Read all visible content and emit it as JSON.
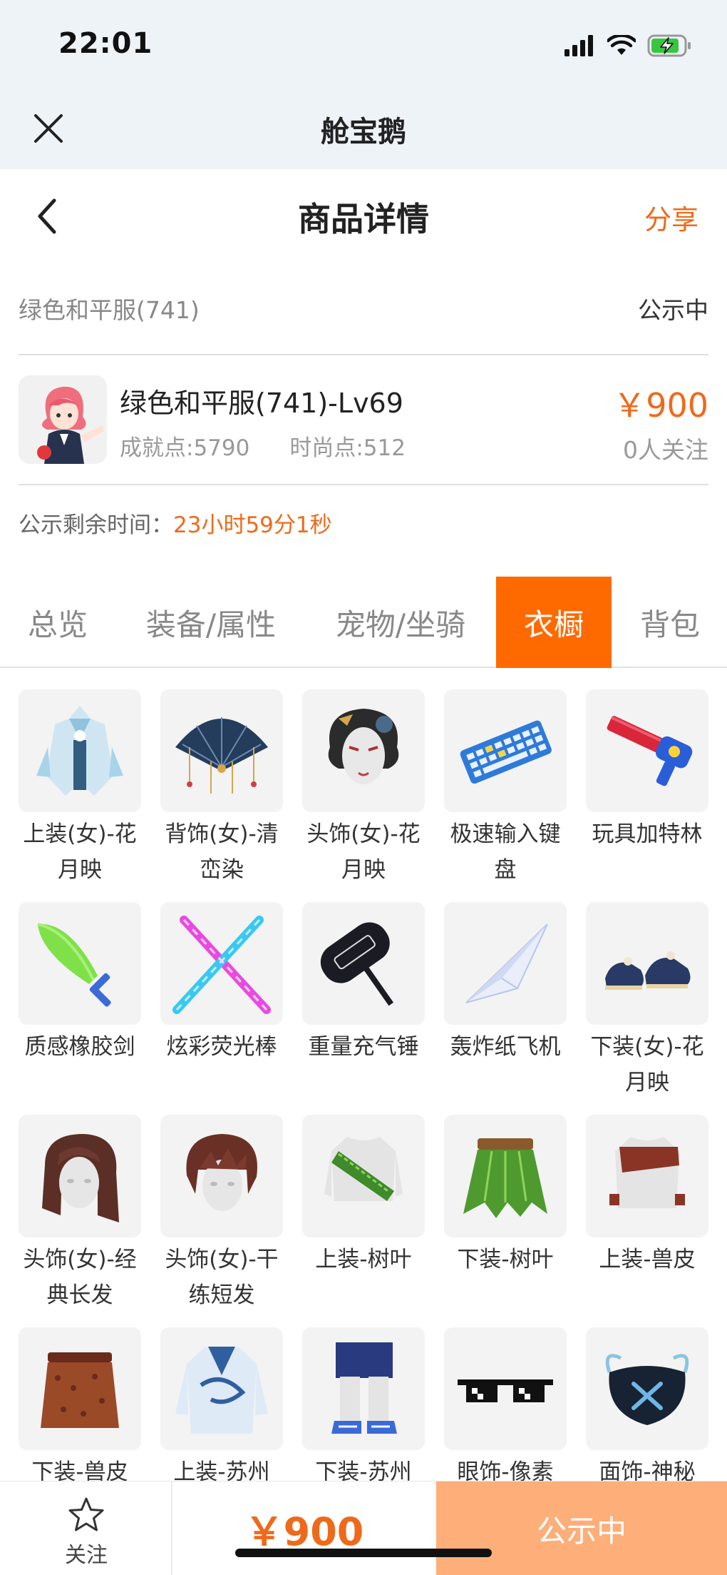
{
  "status_bar": {
    "time": "22:01"
  },
  "app_bar": {
    "title": "舱宝鹅"
  },
  "page_header": {
    "title": "商品详情",
    "share_label": "分享"
  },
  "summary": {
    "name": "绿色和平服(741)",
    "status": "公示中"
  },
  "product": {
    "name": "绿色和平服(741)-Lv69",
    "achievement": "成就点:5790",
    "fashion": "时尚点:512",
    "price": "￥900",
    "followers": "0人关注"
  },
  "remaining": {
    "label": "公示剩余时间：",
    "value": "23小时59分1秒"
  },
  "tabs": [
    {
      "label": "总览"
    },
    {
      "label": "装备/属性"
    },
    {
      "label": "宠物/坐骑"
    },
    {
      "label": "衣橱",
      "active": true
    },
    {
      "label": "背包"
    }
  ],
  "items": [
    {
      "name": "上装(女)-花月映",
      "icon": "outfit-icon"
    },
    {
      "name": "背饰(女)-清峦染",
      "icon": "fan-icon"
    },
    {
      "name": "头饰(女)-花月映",
      "icon": "headdress-icon"
    },
    {
      "name": "极速输入键盘",
      "icon": "keyboard-icon"
    },
    {
      "name": "玩具加特林",
      "icon": "toy-gun-icon"
    },
    {
      "name": "质感橡胶剑",
      "icon": "sword-icon"
    },
    {
      "name": "炫彩荧光棒",
      "icon": "glowstick-icon"
    },
    {
      "name": "重量充气锤",
      "icon": "hammer-icon"
    },
    {
      "name": "轰炸纸飞机",
      "icon": "paper-plane-icon"
    },
    {
      "name": "下装(女)-花月映",
      "icon": "shoes-icon"
    },
    {
      "name": "头饰(女)-经典长发",
      "icon": "hair-icon"
    },
    {
      "name": "头饰(女)-干练短发",
      "icon": "hair-icon"
    },
    {
      "name": "上装-树叶",
      "icon": "leaf-top-icon"
    },
    {
      "name": "下装-树叶",
      "icon": "leaf-skirt-icon"
    },
    {
      "name": "上装-兽皮",
      "icon": "fur-top-icon"
    },
    {
      "name": "下装-兽皮",
      "icon": "fur-skirt-icon"
    },
    {
      "name": "上装-苏州",
      "icon": "suzhou-top-icon"
    },
    {
      "name": "下装-苏州",
      "icon": "suzhou-pants-icon"
    },
    {
      "name": "眼饰-像素",
      "icon": "pixel-glasses-icon"
    },
    {
      "name": "面饰-神秘",
      "icon": "mask-icon"
    }
  ],
  "bottom_bar": {
    "follow_label": "关注",
    "price": "￥900",
    "status_label": "公示中"
  },
  "colors": {
    "accent": "#ee6a1a",
    "tab_active": "#ff6a00",
    "status_button": "#fdae79"
  }
}
